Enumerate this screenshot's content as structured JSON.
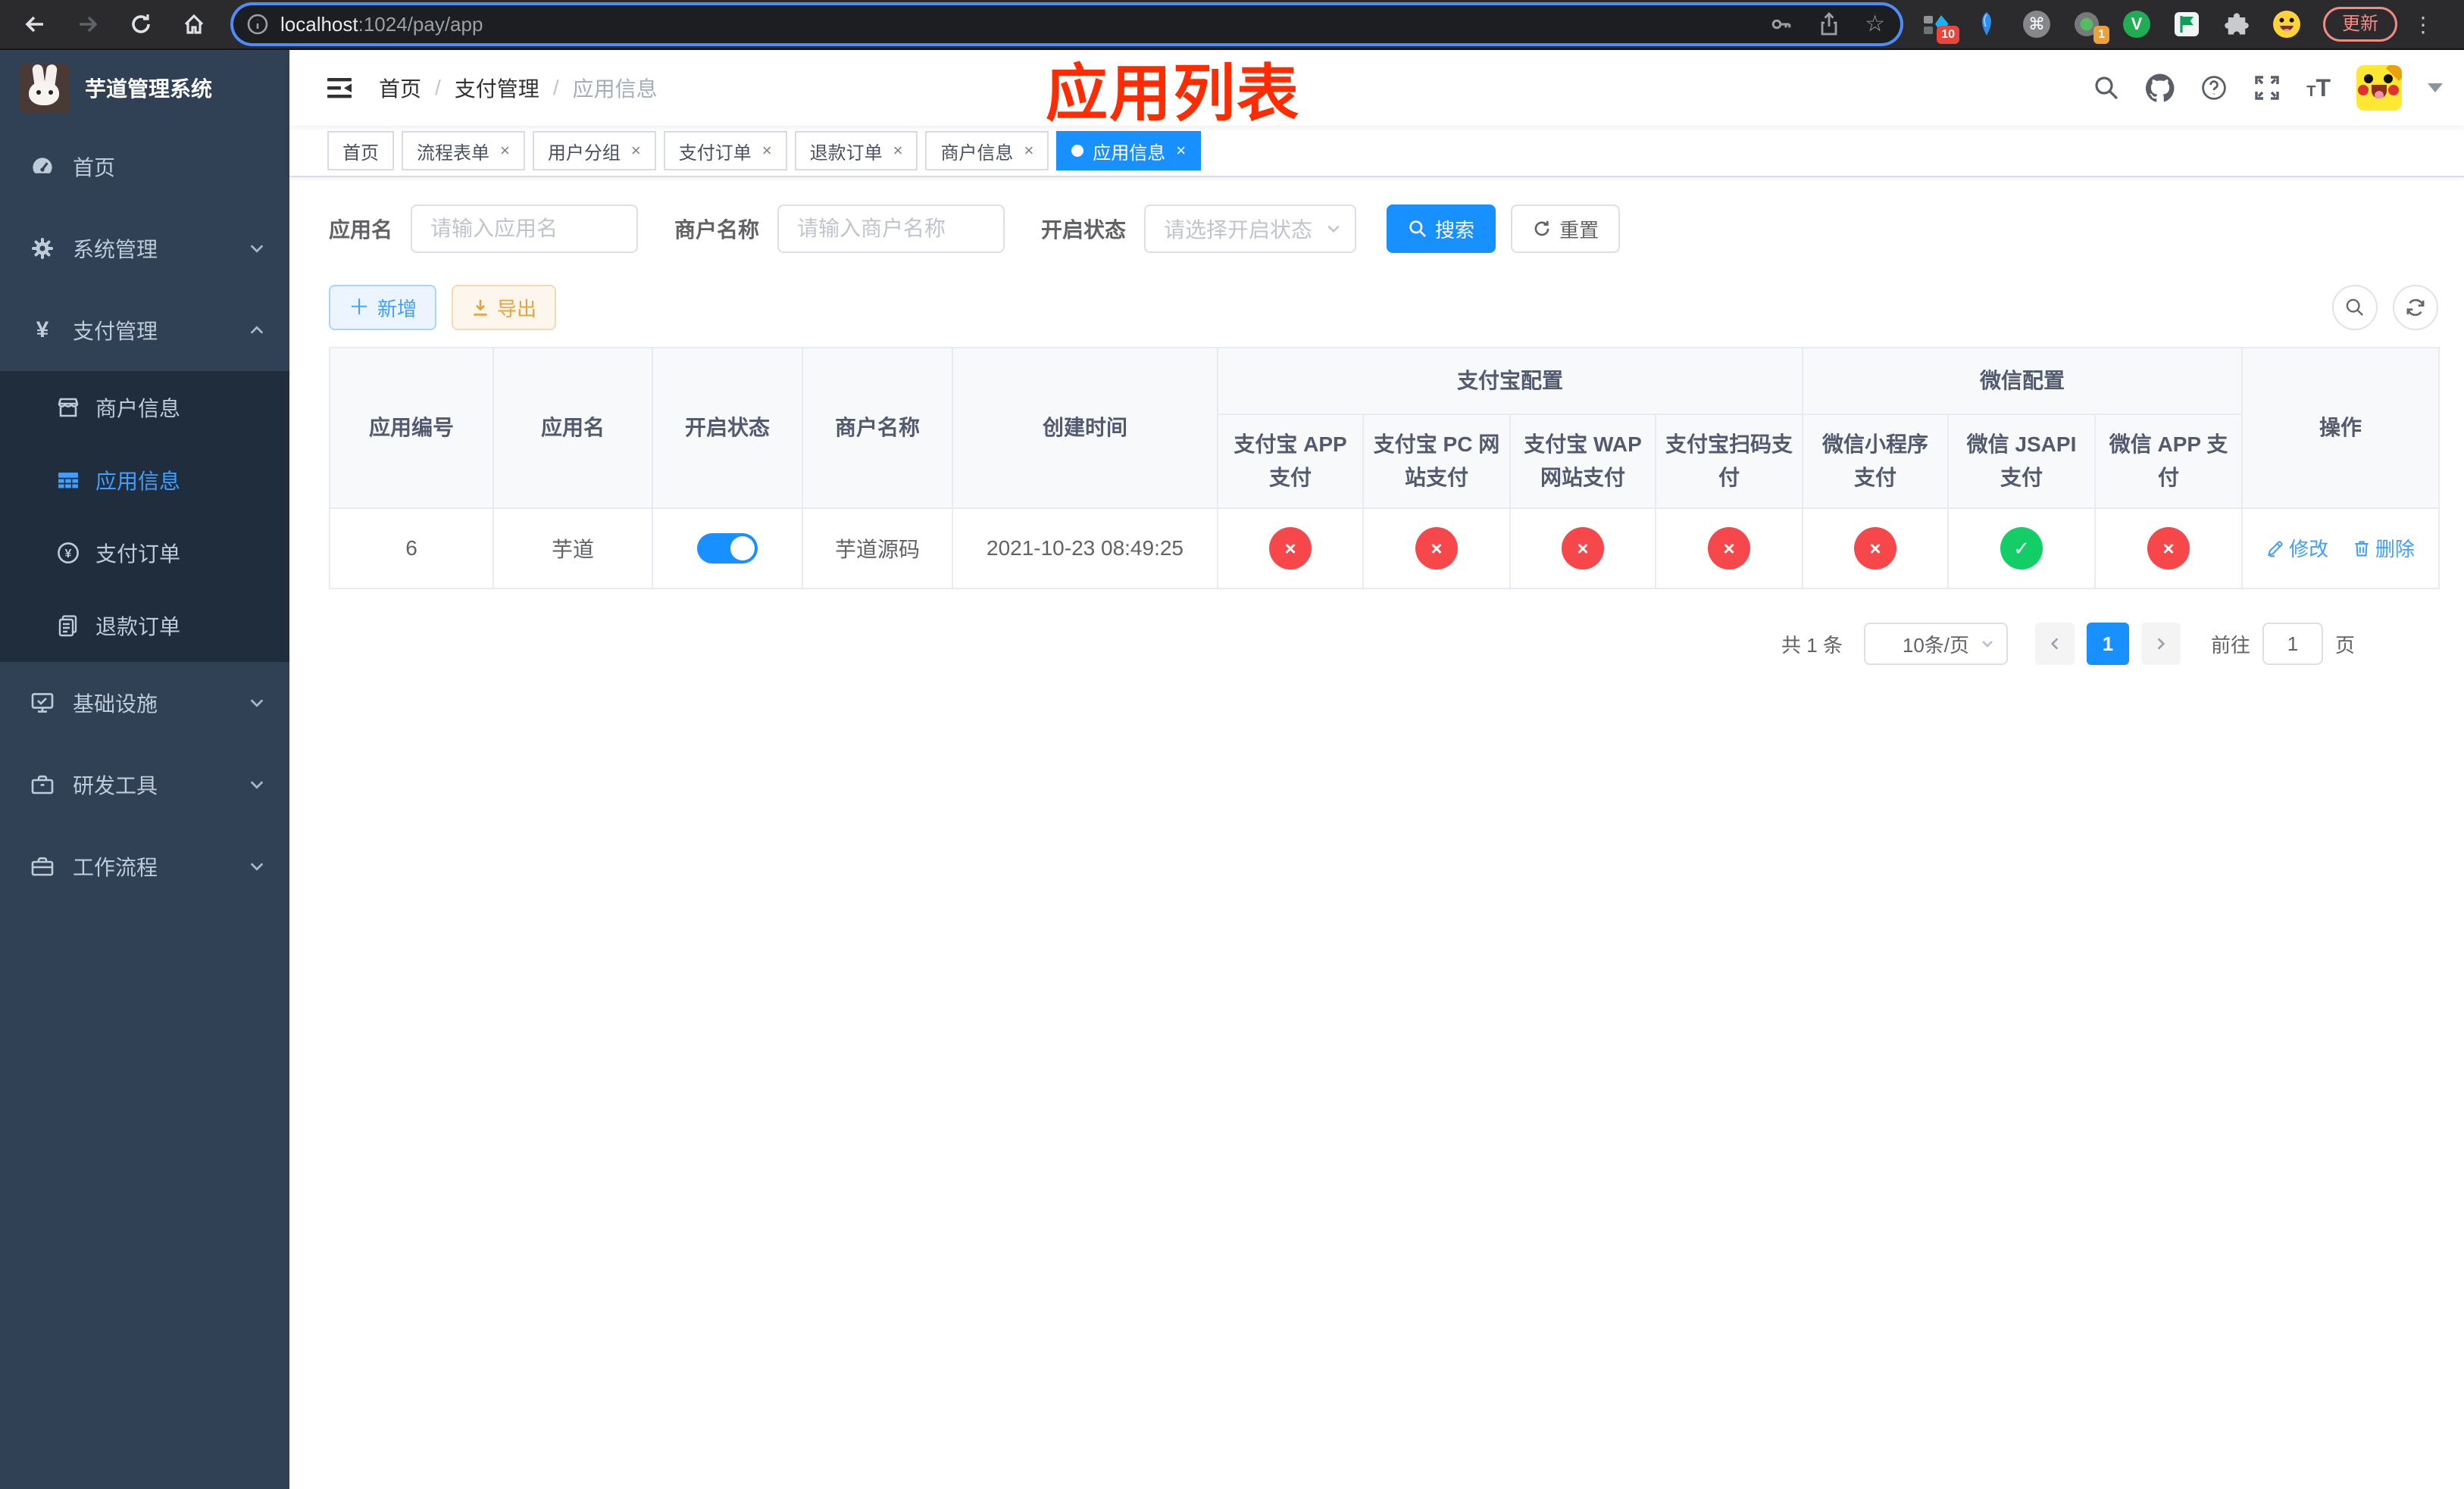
{
  "browser": {
    "url_host": "localhost",
    "url_path": ":1024/pay/app",
    "update_label": "更新",
    "ext_badge_blue": "10",
    "ext_badge_record": "1"
  },
  "app": {
    "title": "芋道管理系统"
  },
  "sidebar": {
    "items": [
      {
        "label": "首页"
      },
      {
        "label": "系统管理"
      },
      {
        "label": "支付管理"
      },
      {
        "label": "商户信息"
      },
      {
        "label": "应用信息"
      },
      {
        "label": "支付订单"
      },
      {
        "label": "退款订单"
      },
      {
        "label": "基础设施"
      },
      {
        "label": "研发工具"
      },
      {
        "label": "工作流程"
      }
    ]
  },
  "navbar": {
    "breadcrumb": [
      "首页",
      "支付管理",
      "应用信息"
    ],
    "annotation": "应用列表"
  },
  "tabs": [
    {
      "label": "首页"
    },
    {
      "label": "流程表单"
    },
    {
      "label": "用户分组"
    },
    {
      "label": "支付订单"
    },
    {
      "label": "退款订单"
    },
    {
      "label": "商户信息"
    },
    {
      "label": "应用信息"
    }
  ],
  "filters": {
    "app_name_label": "应用名",
    "app_name_placeholder": "请输入应用名",
    "merchant_label": "商户名称",
    "merchant_placeholder": "请输入商户名称",
    "status_label": "开启状态",
    "status_placeholder": "请选择开启状态",
    "search_label": "搜索",
    "reset_label": "重置"
  },
  "toolbar": {
    "add_label": "新增",
    "export_label": "导出"
  },
  "table": {
    "headers": {
      "app_id": "应用编号",
      "app_name": "应用名",
      "status": "开启状态",
      "merchant": "商户名称",
      "created": "创建时间",
      "alipay_group": "支付宝配置",
      "wechat_group": "微信配置",
      "pay_cols": [
        "支付宝 APP 支付",
        "支付宝 PC 网站支付",
        "支付宝 WAP 网站支付",
        "支付宝扫码支付",
        "微信小程序支付",
        "微信 JSAPI 支付",
        "微信 APP 支付"
      ],
      "actions": "操作"
    },
    "row": {
      "id": "6",
      "name": "芋道",
      "enabled": true,
      "merchant": "芋道源码",
      "created": "2021-10-23 08:49:25",
      "pay": [
        false,
        false,
        false,
        false,
        false,
        true,
        false
      ],
      "edit_label": "修改",
      "delete_label": "删除"
    }
  },
  "pagination": {
    "total": "共 1 条",
    "page_size": "10条/页",
    "page": "1",
    "goto_label": "前往",
    "goto_value": "1",
    "unit_label": "页"
  },
  "colors": {
    "primary": "#1890ff",
    "link": "#409eff",
    "success": "#13ce66",
    "danger": "#f6474b",
    "warning": "#e6a23c",
    "annotation_red": "#fe2c00",
    "sidebar_bg": "#304156",
    "submenu_bg": "#1f2d3d"
  }
}
